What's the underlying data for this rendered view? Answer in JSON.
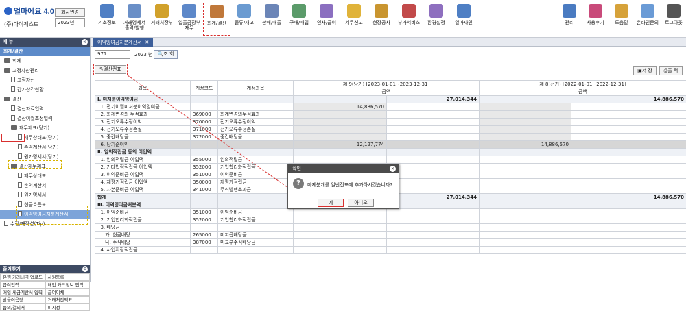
{
  "app": {
    "logo": "얼마에요 4.0",
    "company": "(주)아이퀘스트",
    "change_company": "회사변경",
    "year": "2023년"
  },
  "toolbar": [
    "기초정보",
    "거래명세서\n출력/발행",
    "거래처장부",
    "입출금장부\n재무",
    "회계/결산",
    "물류/재고",
    "판매/매출",
    "구매/매입",
    "인사/급여",
    "세무신고",
    "현장공사",
    "부가서비스",
    "환경설정",
    "얼마짜인"
  ],
  "toolbar_right": [
    "관리",
    "사용후기",
    "도움말",
    "온라인문의",
    "로그아웃"
  ],
  "left": {
    "menu_title": "메 뉴",
    "section": "회계/결산",
    "tree": [
      {
        "label": "회계",
        "lvl": 0,
        "type": "folder"
      },
      {
        "label": "고정자산관리",
        "lvl": 0,
        "type": "folder"
      },
      {
        "label": "고정자산",
        "lvl": 1,
        "type": "page"
      },
      {
        "label": "감가상각현황",
        "lvl": 1,
        "type": "page"
      },
      {
        "label": "결산",
        "lvl": 0,
        "type": "folder"
      },
      {
        "label": "결산자료입력",
        "lvl": 1,
        "type": "page"
      },
      {
        "label": "결산이월조정입력",
        "lvl": 1,
        "type": "page"
      },
      {
        "label": "재무제표(당기)",
        "lvl": 1,
        "type": "folder"
      },
      {
        "label": "재무상태표(당기)",
        "lvl": 2,
        "type": "page"
      },
      {
        "label": "손익계산서(당기)",
        "lvl": 2,
        "type": "page"
      },
      {
        "label": "원가명세서(당기)",
        "lvl": 2,
        "type": "page"
      },
      {
        "label": "결산재무제표",
        "lvl": 1,
        "type": "folder"
      },
      {
        "label": "재무상태표",
        "lvl": 2,
        "type": "page"
      },
      {
        "label": "손익계산서",
        "lvl": 2,
        "type": "page"
      },
      {
        "label": "원가명세서",
        "lvl": 2,
        "type": "page"
      },
      {
        "label": "현금흐름표",
        "lvl": 2,
        "type": "page"
      },
      {
        "label": "이익잉여금처분계산서",
        "lvl": 2,
        "type": "page"
      },
      {
        "label": "수정/재작성(Tip)",
        "lvl": 0,
        "type": "page"
      }
    ],
    "fav_title": "즐겨찾기",
    "fav": [
      "은행 거래내역 업로드",
      "사원등록",
      "급여입력",
      "매입 카드정보 입력",
      "매입 세금계산서 입력",
      "급여이체",
      "받을어음장",
      "거래처잔액표",
      "품의/결의서",
      "미지정"
    ]
  },
  "main": {
    "tab": "이익잉여금처분계산서",
    "code": "971",
    "year_label": "2023 년",
    "search": "조 회",
    "close_btn": "결산전표",
    "save": "저 장",
    "print": "출 력",
    "head": {
      "c1": "과목",
      "c2": "계정코드",
      "c3": "계정과목",
      "p1": "제 9(당기) [2023-01-01~2023-12-31]",
      "p2": "제 8(전기) [2022-01-01~2022-12-31]",
      "amt": "금액"
    },
    "rows": [
      {
        "t": "sec",
        "s": "Ⅰ. 미처분이익잉여금",
        "code": "",
        "name": "",
        "a": "",
        "b": "27,014,344",
        "c": "",
        "d": "14,886,570"
      },
      {
        "t": "",
        "s": "  1. 전기이월미처분이익잉여금",
        "code": "",
        "name": "",
        "a": "14,886,570",
        "b": "",
        "c": "",
        "d": ""
      },
      {
        "t": "",
        "s": "  2. 회계변경의 누적효과",
        "code": "369000",
        "name": "회계변경의누적효과",
        "a": "",
        "b": "",
        "c": "",
        "d": ""
      },
      {
        "t": "",
        "s": "  3. 전기오류수정이익",
        "code": "370000",
        "name": "전기오류수정이익",
        "a": "",
        "b": "",
        "c": "",
        "d": ""
      },
      {
        "t": "",
        "s": "  4. 전기오류수정손실",
        "code": "371000",
        "name": "전기오류수정손실",
        "a": "",
        "b": "",
        "c": "",
        "d": ""
      },
      {
        "t": "",
        "s": "  5. 중간배당금",
        "code": "372000",
        "name": "중간배당금",
        "a": "",
        "b": "",
        "c": "",
        "d": ""
      },
      {
        "t": "gray",
        "s": "  6. 당기순이익",
        "code": "",
        "name": "",
        "a": "12,127,774",
        "b": "",
        "c": "14,886,570",
        "d": ""
      },
      {
        "t": "sec",
        "s": "Ⅱ. 임의적립금 등의 이입액",
        "code": "",
        "name": "",
        "a": "",
        "b": "",
        "c": "",
        "d": ""
      },
      {
        "t": "",
        "s": "  1. 임의적립금 이입액",
        "code": "355000",
        "name": "임의적립금",
        "a": "",
        "b": "",
        "c": "",
        "d": ""
      },
      {
        "t": "",
        "s": "  2. 기타법정적립금 이입액",
        "code": "352000",
        "name": "기업합리화적립금",
        "a": "",
        "b": "",
        "c": "",
        "d": ""
      },
      {
        "t": "",
        "s": "  3. 이익준비금 이입액",
        "code": "351000",
        "name": "이익준비금",
        "a": "",
        "b": "",
        "c": "",
        "d": ""
      },
      {
        "t": "",
        "s": "  4. 재평가적립금 이입액",
        "code": "350000",
        "name": "재평가적립금",
        "a": "",
        "b": "",
        "c": "",
        "d": ""
      },
      {
        "t": "",
        "s": "  5. 자본준비금 이입액",
        "code": "341000",
        "name": "주식발행초과금",
        "a": "",
        "b": "",
        "c": "",
        "d": ""
      },
      {
        "t": "sec",
        "s": "합계",
        "code": "",
        "name": "",
        "a": "",
        "b": "27,014,344",
        "c": "",
        "d": "14,886,570"
      },
      {
        "t": "sec",
        "s": "Ⅲ. 이익잉여금처분액",
        "code": "",
        "name": "",
        "a": "",
        "b": "",
        "c": "",
        "d": ""
      },
      {
        "t": "",
        "s": "  1. 이익준비금",
        "code": "351000",
        "name": "이익준비금",
        "a": "",
        "b": "",
        "c": "",
        "d": ""
      },
      {
        "t": "",
        "s": "  2. 기업합리화적립금",
        "code": "352000",
        "name": "기업합리화적립금",
        "a": "",
        "b": "",
        "c": "",
        "d": ""
      },
      {
        "t": "",
        "s": "  3. 배당금",
        "code": "",
        "name": "",
        "a": "",
        "b": "",
        "c": "",
        "d": ""
      },
      {
        "t": "",
        "s": "     가. 현금배당",
        "code": "265000",
        "name": "미지급배당금",
        "a": "",
        "b": "",
        "c": "",
        "d": ""
      },
      {
        "t": "",
        "s": "     나. 주식배당",
        "code": "387000",
        "name": "미교부주식배당금",
        "a": "",
        "b": "",
        "c": "",
        "d": ""
      },
      {
        "t": "",
        "s": "  4. 사업확장적립금",
        "code": "",
        "name": "",
        "a": "",
        "b": "",
        "c": "",
        "d": ""
      }
    ]
  },
  "dialog": {
    "title": "확인",
    "msg": "마제분개를 일반전표에 추가하시겠습니까?",
    "yes": "예",
    "no": "아니오"
  },
  "colors": {
    "accent": "#3d5f9a",
    "highlight": "#d9302f",
    "dashed": "#d8b400"
  }
}
